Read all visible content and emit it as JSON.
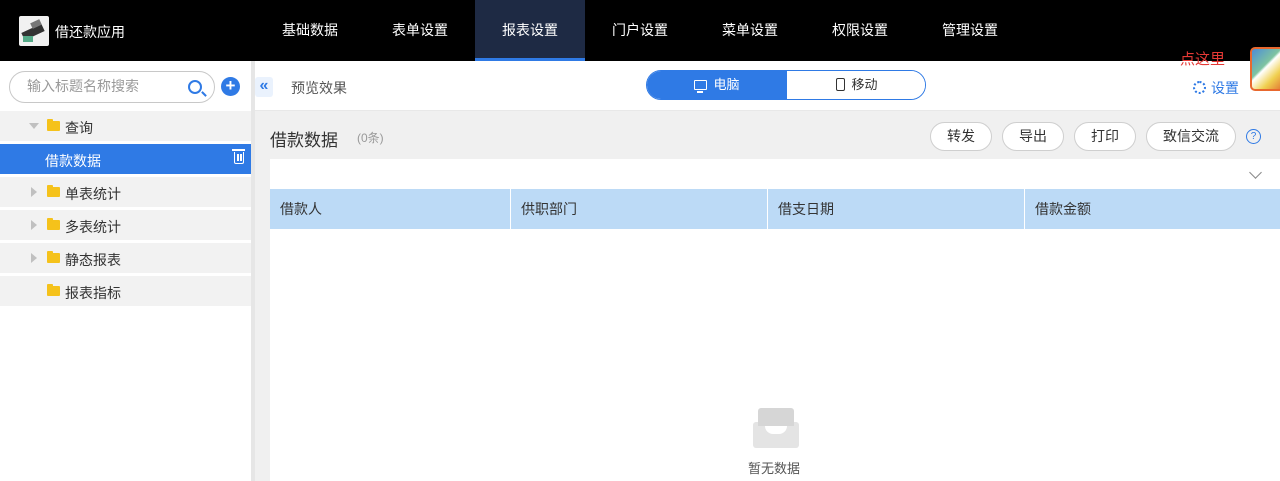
{
  "app": {
    "title": "借还款应用",
    "nav": [
      "基础数据",
      "表单设置",
      "报表设置",
      "门户设置",
      "菜单设置",
      "权限设置",
      "管理设置"
    ],
    "active_nav": "报表设置"
  },
  "sidebar": {
    "search_placeholder": "输入标题名称搜索",
    "items": [
      {
        "label": "查询",
        "type": "folder",
        "expanded": true
      },
      {
        "label": "借款数据",
        "type": "report",
        "selected": true
      },
      {
        "label": "单表统计",
        "type": "folder",
        "expanded": false
      },
      {
        "label": "多表统计",
        "type": "folder",
        "expanded": false
      },
      {
        "label": "静态报表",
        "type": "folder",
        "expanded": false
      },
      {
        "label": "报表指标",
        "type": "folder",
        "expanded": false
      }
    ]
  },
  "header": {
    "preview_label": "预览效果",
    "device_toggle": {
      "pc": "电脑",
      "mobile": "移动",
      "active": "电脑"
    },
    "hint": "点这里",
    "settings_label": "设置"
  },
  "report": {
    "title": "借款数据",
    "count": "(0条)",
    "actions": [
      "转发",
      "导出",
      "打印",
      "致信交流"
    ],
    "help": "?",
    "columns": [
      "借款人",
      "供职部门",
      "借支日期",
      "借款金额"
    ],
    "empty_text": "暂无数据"
  },
  "colors": {
    "accent": "#2f7ae5",
    "header_bg": "#bcdaf6",
    "hint": "#e53935"
  }
}
